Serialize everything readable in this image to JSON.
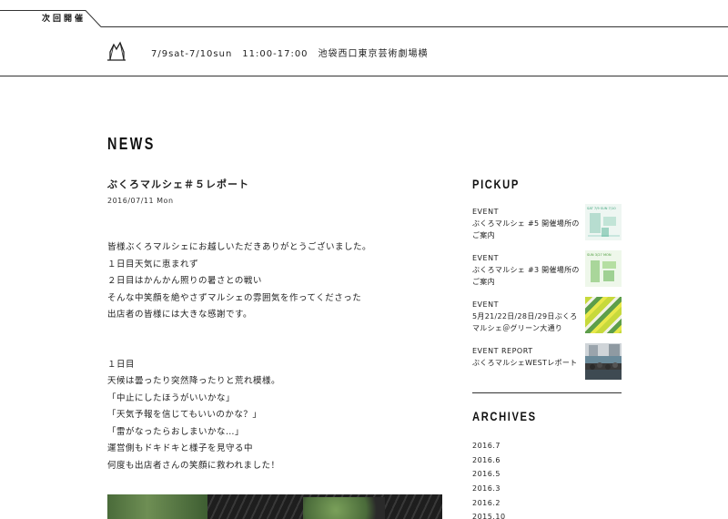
{
  "banner": {
    "tab_label": "次回開催",
    "event_info": "7/9sat-7/10sun　11:00-17:00　池袋西口東京芸術劇場横"
  },
  "section": {
    "title": "NEWS"
  },
  "article": {
    "title": "ぶくろマルシェ＃５レポート",
    "date": "2016/07/11 Mon",
    "paragraph1": [
      "皆様ぶくろマルシェにお越しいただきありがとうございました。",
      "１日目天気に恵まれず",
      "２日目はかんかん照りの暑さとの戦い",
      "そんな中笑顔を絶やさずマルシェの雰囲気を作ってくださった",
      "出店者の皆様には大きな感謝です。"
    ],
    "paragraph2": [
      "１日目",
      "天候は曇ったり突然降ったりと荒れ模様。",
      "「中止にしたほうがいいかな」",
      "「天気予報を信じてもいいのかな？」",
      "「雷がなったらおしまいかな…」",
      "運営側もドキドキと様子を見守る中",
      "何度も出店者さんの笑顔に救われました！"
    ]
  },
  "sidebar": {
    "pickup_title": "PICKUP",
    "pickup": [
      {
        "category": "EVENT",
        "name": "ぶくろマルシェ #5 開催場所のご案内",
        "thumb_text": "SAT 7/9 SUN 7/10"
      },
      {
        "category": "EVENT",
        "name": "ぶくろマルシェ #3 開催場所のご案内",
        "thumb_text": "SUN 3/27 MON"
      },
      {
        "category": "EVENT",
        "name": "5月21/22日/28日/29日ぶくろマルシェ＠グリーン大通り"
      },
      {
        "category": "EVENT REPORT",
        "name": "ぶくろマルシェWESTレポート"
      }
    ],
    "archives_title": "ARCHIVES",
    "archives": [
      "2016.7",
      "2016.6",
      "2016.5",
      "2016.3",
      "2016.2",
      "2015.10"
    ]
  },
  "colors": {
    "text": "#222222",
    "rule": "#333333",
    "background": "#ffffff"
  }
}
